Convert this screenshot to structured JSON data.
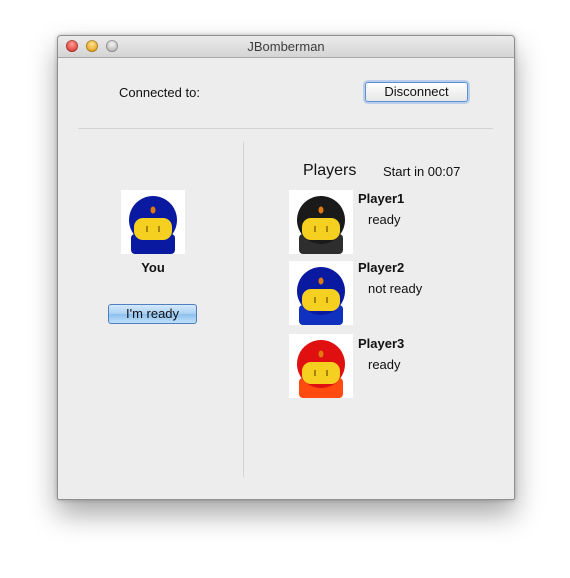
{
  "window": {
    "title": "JBomberman"
  },
  "connection": {
    "label": "Connected to:",
    "disconnect_label": "Disconnect"
  },
  "you": {
    "label": "You",
    "ready_button": "I'm ready",
    "helmet_color": "#0a1aa0"
  },
  "players": {
    "heading": "Players",
    "countdown": "Start in 00:07",
    "list": [
      {
        "name": "Player1",
        "status": "ready",
        "helmet_color": "#1a1a1a",
        "body_color": "#2e2e2e"
      },
      {
        "name": "Player2",
        "status": "not ready",
        "helmet_color": "#0a1aa0",
        "body_color": "#1030c0"
      },
      {
        "name": "Player3",
        "status": "ready",
        "helmet_color": "#e01010",
        "body_color": "#ff4a10"
      }
    ]
  },
  "colors": {
    "face": "#f5d020",
    "visor_line": "#8a6a10",
    "forehead_dot": "#e07a10"
  }
}
